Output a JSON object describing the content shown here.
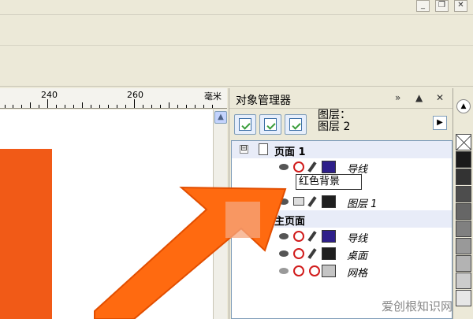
{
  "window": {
    "minimize_glyph": "_",
    "restore_glyph": "❐",
    "close_glyph": "✕"
  },
  "ruler": {
    "labels": [
      "240",
      "260"
    ],
    "unit": "毫米"
  },
  "docker": {
    "title": "对象管理器",
    "expand_glyph": "»",
    "collapse_glyph": "▲",
    "close_glyph": "✕",
    "layer_label": "图层：",
    "layer_name": "图层 2",
    "arrow_glyph": "▶"
  },
  "tree": {
    "page": {
      "label": "页面 1",
      "expander": "⊟"
    },
    "page_layers": [
      {
        "name": "导线",
        "swatch": "#2e1f8a"
      }
    ],
    "rename_value": "红色背景",
    "layer1": {
      "name": "图层 1",
      "swatch": "#1f1f1f"
    },
    "master": {
      "label": "主页面"
    },
    "master_layers": [
      {
        "name": "导线",
        "swatch": "#2e1f8a"
      },
      {
        "name": "桌面",
        "swatch": "#1f1f1f"
      },
      {
        "name": "网格",
        "swatch": "#c4c4c4"
      }
    ]
  },
  "palette": {
    "up_glyph": "▲",
    "colors": [
      "#ffffff",
      "#1a1a1a",
      "#333333",
      "#4d4d4d",
      "#666666",
      "#808080",
      "#999999",
      "#b3b3b3",
      "#cccccc",
      "#e6e6e6"
    ]
  },
  "watermark": "爱创根知识网",
  "colors": {
    "accent_orange": "#f15a17",
    "arrow_orange": "#ff6a10"
  }
}
